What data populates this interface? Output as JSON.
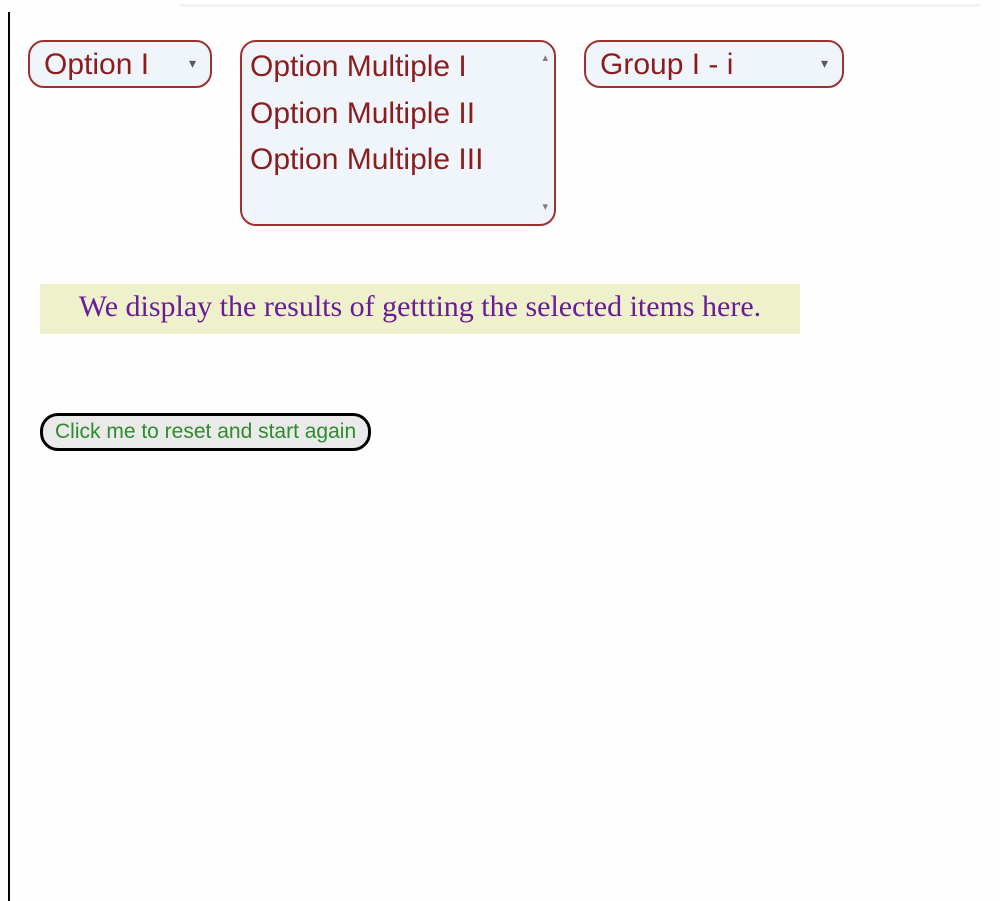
{
  "controls": {
    "single_select": {
      "selected": "Option I"
    },
    "multi_select": {
      "options": [
        "Option Multiple I",
        "Option Multiple II",
        "Option Multiple III"
      ]
    },
    "group_select": {
      "selected": "Group I - i"
    }
  },
  "results_panel": {
    "text": "We display the results of gettting the selected items here."
  },
  "reset_button": {
    "label": "Click me to reset and start again"
  },
  "icons": {
    "caret_down": "▾",
    "scroll_up": "▴",
    "scroll_down": "▾"
  }
}
